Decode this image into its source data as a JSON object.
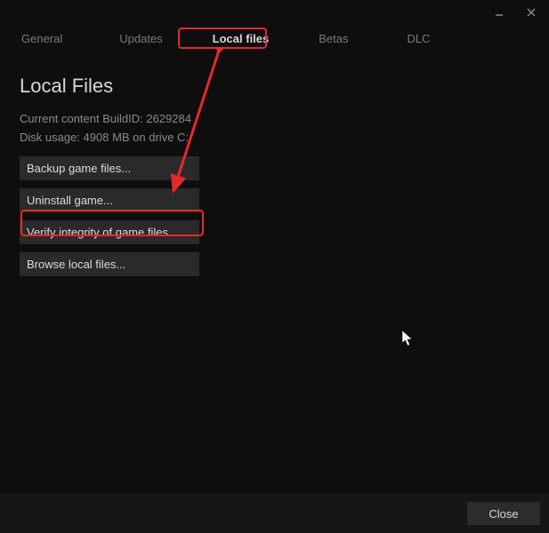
{
  "tabs": {
    "general": "General",
    "updates": "Updates",
    "local_files": "Local files",
    "betas": "Betas",
    "dlc": "DLC"
  },
  "page": {
    "title": "Local Files",
    "build_info": "Current content BuildID: 2629284",
    "disk_usage": "Disk usage: 4908 MB on drive C:"
  },
  "buttons": {
    "backup": "Backup game files...",
    "uninstall": "Uninstall game...",
    "verify": "Verify integrity of game files...",
    "browse": "Browse local files..."
  },
  "footer": {
    "close": "Close"
  }
}
